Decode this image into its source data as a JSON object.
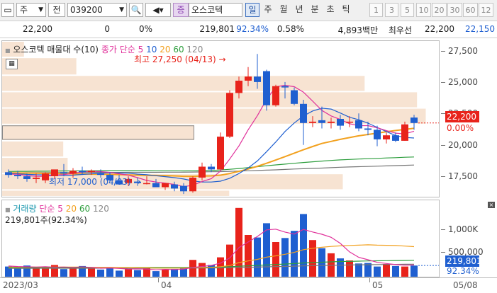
{
  "toolbar": {
    "market": "주",
    "period_small": "전",
    "code": "039200",
    "badge": "증",
    "stock_name": "오스코텍",
    "period_buttons": [
      "일",
      "주",
      "월",
      "년",
      "분",
      "초",
      "틱"
    ],
    "selected_period": "일",
    "num_buttons": [
      "1",
      "3",
      "5",
      "10",
      "20",
      "30",
      "60",
      "12"
    ]
  },
  "info": {
    "price": "22,200",
    "change": "0",
    "change_pct": "0%",
    "volume": "219,801",
    "volume_ratio": "92.34%",
    "turnover_rate": "0.58%",
    "trade_value": "4,893백만",
    "best_ask_label": "최우선",
    "best_ask": "22,200",
    "best_bid": "22,150"
  },
  "price_pane": {
    "title": "오스코텍 매물대 수(10)",
    "ma_legend": {
      "label": "종가 단순",
      "periods": [
        "5",
        "10",
        "20",
        "60",
        "120"
      ]
    },
    "high_annotation": "최고 27,250 (04/13)",
    "low_annotation": "최저 17,000 (04/03)",
    "y_labels": [
      "27,500",
      "25,000",
      "22,500",
      "20,000",
      "17,500"
    ],
    "current_price_box": "22,200",
    "current_change_box": "0.00%"
  },
  "volume_pane": {
    "legend_label": "거래량",
    "legend_ma": "단순",
    "legend_periods": [
      "5",
      "20",
      "60",
      "120"
    ],
    "sub_label": "219,801주(92.34%)",
    "y_labels": [
      "1,000K",
      "500,000"
    ],
    "current_volume_box": "219,801",
    "current_ratio_box": "92.34%"
  },
  "x_axis": [
    "2023/03",
    "04",
    "05",
    "05/08"
  ],
  "colors": {
    "up": "#e8231b",
    "down": "#1f5fd0",
    "ma5": "#e0309a",
    "ma10": "#1f5fd0",
    "ma20": "#f2a11f",
    "ma60": "#2e9e3e",
    "ma120": "#777777",
    "profile": "#f7e3d2"
  },
  "chart_data": {
    "type": "candlestick",
    "ylim": [
      16800,
      28200
    ],
    "candles": [
      {
        "o": 18600,
        "h": 18800,
        "l": 18200,
        "c": 18400
      },
      {
        "o": 18400,
        "h": 18700,
        "l": 18100,
        "c": 18300
      },
      {
        "o": 18300,
        "h": 18500,
        "l": 17900,
        "c": 18100
      },
      {
        "o": 18100,
        "h": 18500,
        "l": 17800,
        "c": 18200
      },
      {
        "o": 18000,
        "h": 18600,
        "l": 17800,
        "c": 18500
      },
      {
        "o": 18300,
        "h": 18700,
        "l": 18100,
        "c": 18800
      },
      {
        "o": 18600,
        "h": 19200,
        "l": 18300,
        "c": 18500
      },
      {
        "o": 18500,
        "h": 18900,
        "l": 18200,
        "c": 18700
      },
      {
        "o": 18700,
        "h": 19000,
        "l": 18400,
        "c": 18600
      },
      {
        "o": 18600,
        "h": 18800,
        "l": 18400,
        "c": 18700
      },
      {
        "o": 18500,
        "h": 18800,
        "l": 18200,
        "c": 18400
      },
      {
        "o": 18400,
        "h": 18600,
        "l": 17900,
        "c": 18000
      },
      {
        "o": 18000,
        "h": 18400,
        "l": 17700,
        "c": 17700
      },
      {
        "o": 17800,
        "h": 18300,
        "l": 17600,
        "c": 18100
      },
      {
        "o": 17900,
        "h": 18200,
        "l": 17600,
        "c": 17800
      },
      {
        "o": 17800,
        "h": 18300,
        "l": 17700,
        "c": 17800
      },
      {
        "o": 17800,
        "h": 18100,
        "l": 17500,
        "c": 17500
      },
      {
        "o": 17500,
        "h": 17800,
        "l": 17300,
        "c": 17800
      },
      {
        "o": 17700,
        "h": 17900,
        "l": 17200,
        "c": 17400
      },
      {
        "o": 17600,
        "h": 17800,
        "l": 17000,
        "c": 17200
      },
      {
        "o": 17200,
        "h": 18300,
        "l": 17100,
        "c": 18200
      },
      {
        "o": 18200,
        "h": 19300,
        "l": 18000,
        "c": 19000
      },
      {
        "o": 19000,
        "h": 19200,
        "l": 18600,
        "c": 18800
      },
      {
        "o": 18800,
        "h": 21500,
        "l": 18800,
        "c": 21200
      },
      {
        "o": 21200,
        "h": 24600,
        "l": 21100,
        "c": 24400
      },
      {
        "o": 24400,
        "h": 25600,
        "l": 24000,
        "c": 25300
      },
      {
        "o": 25300,
        "h": 26300,
        "l": 24900,
        "c": 25600
      },
      {
        "o": 25600,
        "h": 27250,
        "l": 24700,
        "c": 25200
      },
      {
        "o": 26000,
        "h": 26100,
        "l": 23100,
        "c": 23500
      },
      {
        "o": 23500,
        "h": 25000,
        "l": 23400,
        "c": 24900
      },
      {
        "o": 24900,
        "h": 25200,
        "l": 24000,
        "c": 24800
      },
      {
        "o": 24600,
        "h": 24800,
        "l": 23500,
        "c": 23600
      },
      {
        "o": 23600,
        "h": 23900,
        "l": 20600,
        "c": 22200
      },
      {
        "o": 22200,
        "h": 22700,
        "l": 21900,
        "c": 22300
      },
      {
        "o": 22400,
        "h": 23400,
        "l": 21800,
        "c": 22200
      },
      {
        "o": 22200,
        "h": 22600,
        "l": 21800,
        "c": 22300
      },
      {
        "o": 22500,
        "h": 22800,
        "l": 21700,
        "c": 22000
      },
      {
        "o": 22300,
        "h": 22700,
        "l": 21900,
        "c": 22300
      },
      {
        "o": 22400,
        "h": 22900,
        "l": 21600,
        "c": 21800
      },
      {
        "o": 21800,
        "h": 22300,
        "l": 21300,
        "c": 21700
      },
      {
        "o": 21700,
        "h": 22000,
        "l": 20500,
        "c": 21000
      },
      {
        "o": 21000,
        "h": 21500,
        "l": 20700,
        "c": 21300
      },
      {
        "o": 21300,
        "h": 21500,
        "l": 20800,
        "c": 20900
      },
      {
        "o": 20900,
        "h": 22300,
        "l": 20900,
        "c": 22100
      },
      {
        "o": 22600,
        "h": 22800,
        "l": 21700,
        "c": 22200
      }
    ],
    "ma": {
      "ma5": [
        18450,
        18450,
        18350,
        18300,
        18300,
        18380,
        18420,
        18500,
        18620,
        18660,
        18640,
        18580,
        18480,
        18380,
        18200,
        17990,
        17880,
        17800,
        17700,
        17540,
        17640,
        17920,
        18120,
        18680,
        19560,
        20520,
        21700,
        22740,
        23920,
        24850,
        24960,
        24860,
        24460,
        23800,
        23120,
        22720,
        22460,
        22150,
        22000,
        22010,
        21850,
        21640,
        21460,
        21400,
        21600
      ],
      "ma10": [
        18500,
        18480,
        18440,
        18410,
        18400,
        18380,
        18360,
        18380,
        18430,
        18480,
        18520,
        18550,
        18540,
        18520,
        18460,
        18410,
        18340,
        18270,
        18200,
        18100,
        17960,
        17880,
        17880,
        17940,
        18150,
        18500,
        18910,
        19420,
        20100,
        20810,
        21580,
        22200,
        22720,
        23080,
        23280,
        23220,
        22930,
        22620,
        22440,
        22190,
        21880,
        21570,
        21290,
        21140,
        21100
      ],
      "ma20": [
        18550,
        18540,
        18530,
        18520,
        18510,
        18500,
        18490,
        18480,
        18470,
        18460,
        18450,
        18440,
        18420,
        18400,
        18380,
        18370,
        18360,
        18350,
        18330,
        18300,
        18300,
        18320,
        18330,
        18380,
        18500,
        18660,
        18830,
        19030,
        19250,
        19490,
        19740,
        19990,
        20240,
        20480,
        20700,
        20850,
        21000,
        21130,
        21260,
        21360,
        21460,
        21560,
        21650,
        21730,
        21810
      ],
      "ma60": [
        18650,
        18660,
        18660,
        18670,
        18670,
        18680,
        18690,
        18690,
        18700,
        18700,
        18710,
        18710,
        18710,
        18710,
        18710,
        18710,
        18700,
        18700,
        18700,
        18690,
        18700,
        18710,
        18720,
        18760,
        18810,
        18870,
        18930,
        19000,
        19070,
        19130,
        19190,
        19250,
        19310,
        19360,
        19410,
        19460,
        19500,
        19530,
        19560,
        19590,
        19610,
        19640,
        19660,
        19690,
        19710
      ],
      "ma120": [
        18550,
        18550,
        18560,
        18560,
        18560,
        18570,
        18570,
        18570,
        18570,
        18580,
        18580,
        18580,
        18580,
        18590,
        18590,
        18590,
        18590,
        18600,
        18600,
        18600,
        18610,
        18620,
        18630,
        18640,
        18660,
        18680,
        18700,
        18720,
        18750,
        18770,
        18800,
        18830,
        18850,
        18880,
        18900,
        18930,
        18960,
        18980,
        19000,
        19020,
        19040,
        19060,
        19080,
        19100,
        19120
      ]
    },
    "volume_ylim": [
      0,
      1500000
    ],
    "volume": [
      200000,
      180000,
      220000,
      160000,
      190000,
      230000,
      150000,
      170000,
      210000,
      160000,
      140000,
      180000,
      120000,
      150000,
      130000,
      170000,
      110000,
      140000,
      150000,
      160000,
      330000,
      270000,
      230000,
      380000,
      630000,
      1350000,
      820000,
      770000,
      1050000,
      680000,
      760000,
      900000,
      1230000,
      720000,
      560000,
      460000,
      360000,
      320000,
      260000,
      270000,
      200000,
      250000,
      210000,
      200000,
      219801
    ],
    "volume_ma5": [
      210000,
      200000,
      195000,
      190000,
      196000,
      186000,
      190000,
      184000,
      192000,
      182000,
      166000,
      172000,
      162000,
      150000,
      154000,
      150000,
      136000,
      144000,
      140000,
      150000,
      180000,
      202000,
      222000,
      266000,
      368000,
      572000,
      680000,
      790000,
      920000,
      934000,
      876000,
      836000,
      928000,
      878000,
      834000,
      774000,
      654000,
      488000,
      380000,
      334000,
      282000,
      260000,
      238000,
      226000,
      230000
    ],
    "volume_ma20": [
      190000,
      190000,
      190000,
      190000,
      190000,
      190000,
      190000,
      190000,
      190000,
      185000,
      185000,
      185000,
      180000,
      180000,
      175000,
      175000,
      170000,
      170000,
      170000,
      170000,
      178000,
      182000,
      185000,
      197000,
      220000,
      278000,
      310000,
      340000,
      385000,
      410000,
      440000,
      478000,
      530000,
      558000,
      578000,
      594000,
      606000,
      614000,
      620000,
      626000,
      620000,
      616000,
      612000,
      602000,
      590000
    ],
    "volume_ma60": [
      175000,
      175000,
      176000,
      176000,
      176000,
      177000,
      177000,
      177000,
      178000,
      178000,
      178000,
      179000,
      179000,
      179000,
      180000,
      180000,
      180000,
      181000,
      181000,
      181000,
      183000,
      185000,
      187000,
      190000,
      196000,
      206000,
      214000,
      222000,
      232000,
      240000,
      248000,
      258000,
      270000,
      278000,
      285000,
      292000,
      298000,
      302000,
      306000,
      310000,
      312000,
      315000,
      318000,
      320000,
      322000
    ],
    "volume_ma120": [
      165000,
      165000,
      165000,
      166000,
      166000,
      166000,
      166000,
      167000,
      167000,
      167000,
      168000,
      168000,
      168000,
      168000,
      169000,
      169000,
      169000,
      170000,
      170000,
      170000,
      171000,
      172000,
      173000,
      174000,
      177000,
      181000,
      185000,
      189000,
      194000,
      198000,
      202000,
      207000,
      212000,
      216000,
      220000,
      224000,
      227000,
      230000,
      233000,
      236000,
      238000,
      240000,
      242000,
      244000,
      246000
    ],
    "volume_profile": [
      {
        "price_from": 27000,
        "price_to": 28200,
        "width": 0.05
      },
      {
        "price_from": 25700,
        "price_to": 27000,
        "width": 0.17
      },
      {
        "price_from": 24500,
        "price_to": 25700,
        "width": 0.83
      },
      {
        "price_from": 23300,
        "price_to": 24500,
        "width": 0.95
      },
      {
        "price_from": 22100,
        "price_to": 23300,
        "width": 0.97
      },
      {
        "price_from": 20900,
        "price_to": 22100,
        "width": 0.44
      },
      {
        "price_from": 19700,
        "price_to": 20900,
        "width": 0.14
      },
      {
        "price_from": 18500,
        "price_to": 19700,
        "width": 0.15
      },
      {
        "price_from": 17300,
        "price_to": 18500,
        "width": 0.78
      },
      {
        "price_from": 16800,
        "price_to": 17300,
        "width": 0.52
      }
    ]
  }
}
